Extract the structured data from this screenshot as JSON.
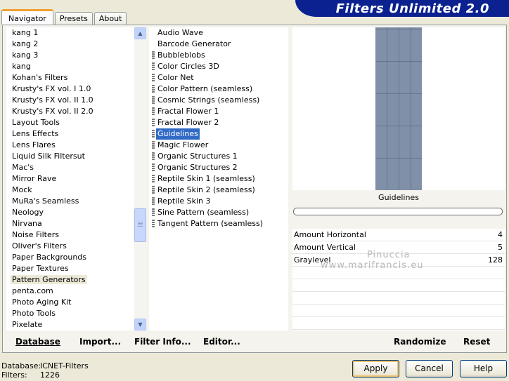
{
  "tabs": [
    "Navigator",
    "Presets",
    "About"
  ],
  "banner_title": "Filters Unlimited 2.0",
  "categories": [
    "kang 1",
    "kang 2",
    "kang 3",
    "kang",
    "Kohan's Filters",
    "Krusty's FX vol. I 1.0",
    "Krusty's FX vol. II 1.0",
    "Krusty's FX vol. II 2.0",
    "Layout Tools",
    "Lens Effects",
    "Lens Flares",
    "Liquid Silk Filtersut",
    "Mac's",
    "Mirror Rave",
    "Mock",
    "MuRa's Seamless",
    "Neology",
    "Nirvana",
    "Noise Filters",
    "Oliver's Filters",
    "Paper Backgrounds",
    "Paper Textures",
    "Pattern Generators",
    "penta.com",
    "Photo Aging Kit",
    "Photo Tools",
    "Pixelate"
  ],
  "selected_category": "Pattern Generators",
  "filters": [
    {
      "label": "Audio Wave",
      "grip": false
    },
    {
      "label": "Barcode Generator",
      "grip": false
    },
    {
      "label": "Bubbleblobs",
      "grip": true
    },
    {
      "label": "Color Circles 3D",
      "grip": true
    },
    {
      "label": "Color Net",
      "grip": true
    },
    {
      "label": "Color Pattern (seamless)",
      "grip": true
    },
    {
      "label": "Cosmic Strings (seamless)",
      "grip": true
    },
    {
      "label": "Fractal Flower 1",
      "grip": true
    },
    {
      "label": "Fractal Flower 2",
      "grip": true
    },
    {
      "label": "Guidelines",
      "grip": true
    },
    {
      "label": "Magic Flower",
      "grip": true
    },
    {
      "label": "Organic Structures 1",
      "grip": true
    },
    {
      "label": "Organic Structures 2",
      "grip": true
    },
    {
      "label": "Reptile Skin 1 (seamless)",
      "grip": true
    },
    {
      "label": "Reptile Skin 2 (seamless)",
      "grip": true
    },
    {
      "label": "Reptile Skin 3",
      "grip": true
    },
    {
      "label": "Sine Pattern (seamless)",
      "grip": true
    },
    {
      "label": "Tangent Pattern (seamless)",
      "grip": true
    }
  ],
  "selected_filter": "Guidelines",
  "preview": {
    "filter_name": "Guidelines",
    "color": "#8090a8"
  },
  "params": [
    {
      "name": "Amount Horizontal",
      "value": "4"
    },
    {
      "name": "Amount Vertical",
      "value": "5"
    },
    {
      "name": "Graylevel",
      "value": "128"
    }
  ],
  "watermark": "Pinuccia\nwww.marifrancis.eu",
  "toolbar": {
    "database": "Database",
    "import": "Import...",
    "filter_info": "Filter Info...",
    "editor": "Editor...",
    "randomize": "Randomize",
    "reset": "Reset"
  },
  "status": {
    "database_label": "Database:",
    "database_value": "ICNET-Filters",
    "filters_label": "Filters:",
    "filters_value": "1226"
  },
  "buttons": {
    "apply": "Apply",
    "cancel": "Cancel",
    "help": "Help"
  },
  "colors": {
    "banner": "#0b2190",
    "selection": "#316ac5",
    "tab_accent": "#f0a030"
  }
}
